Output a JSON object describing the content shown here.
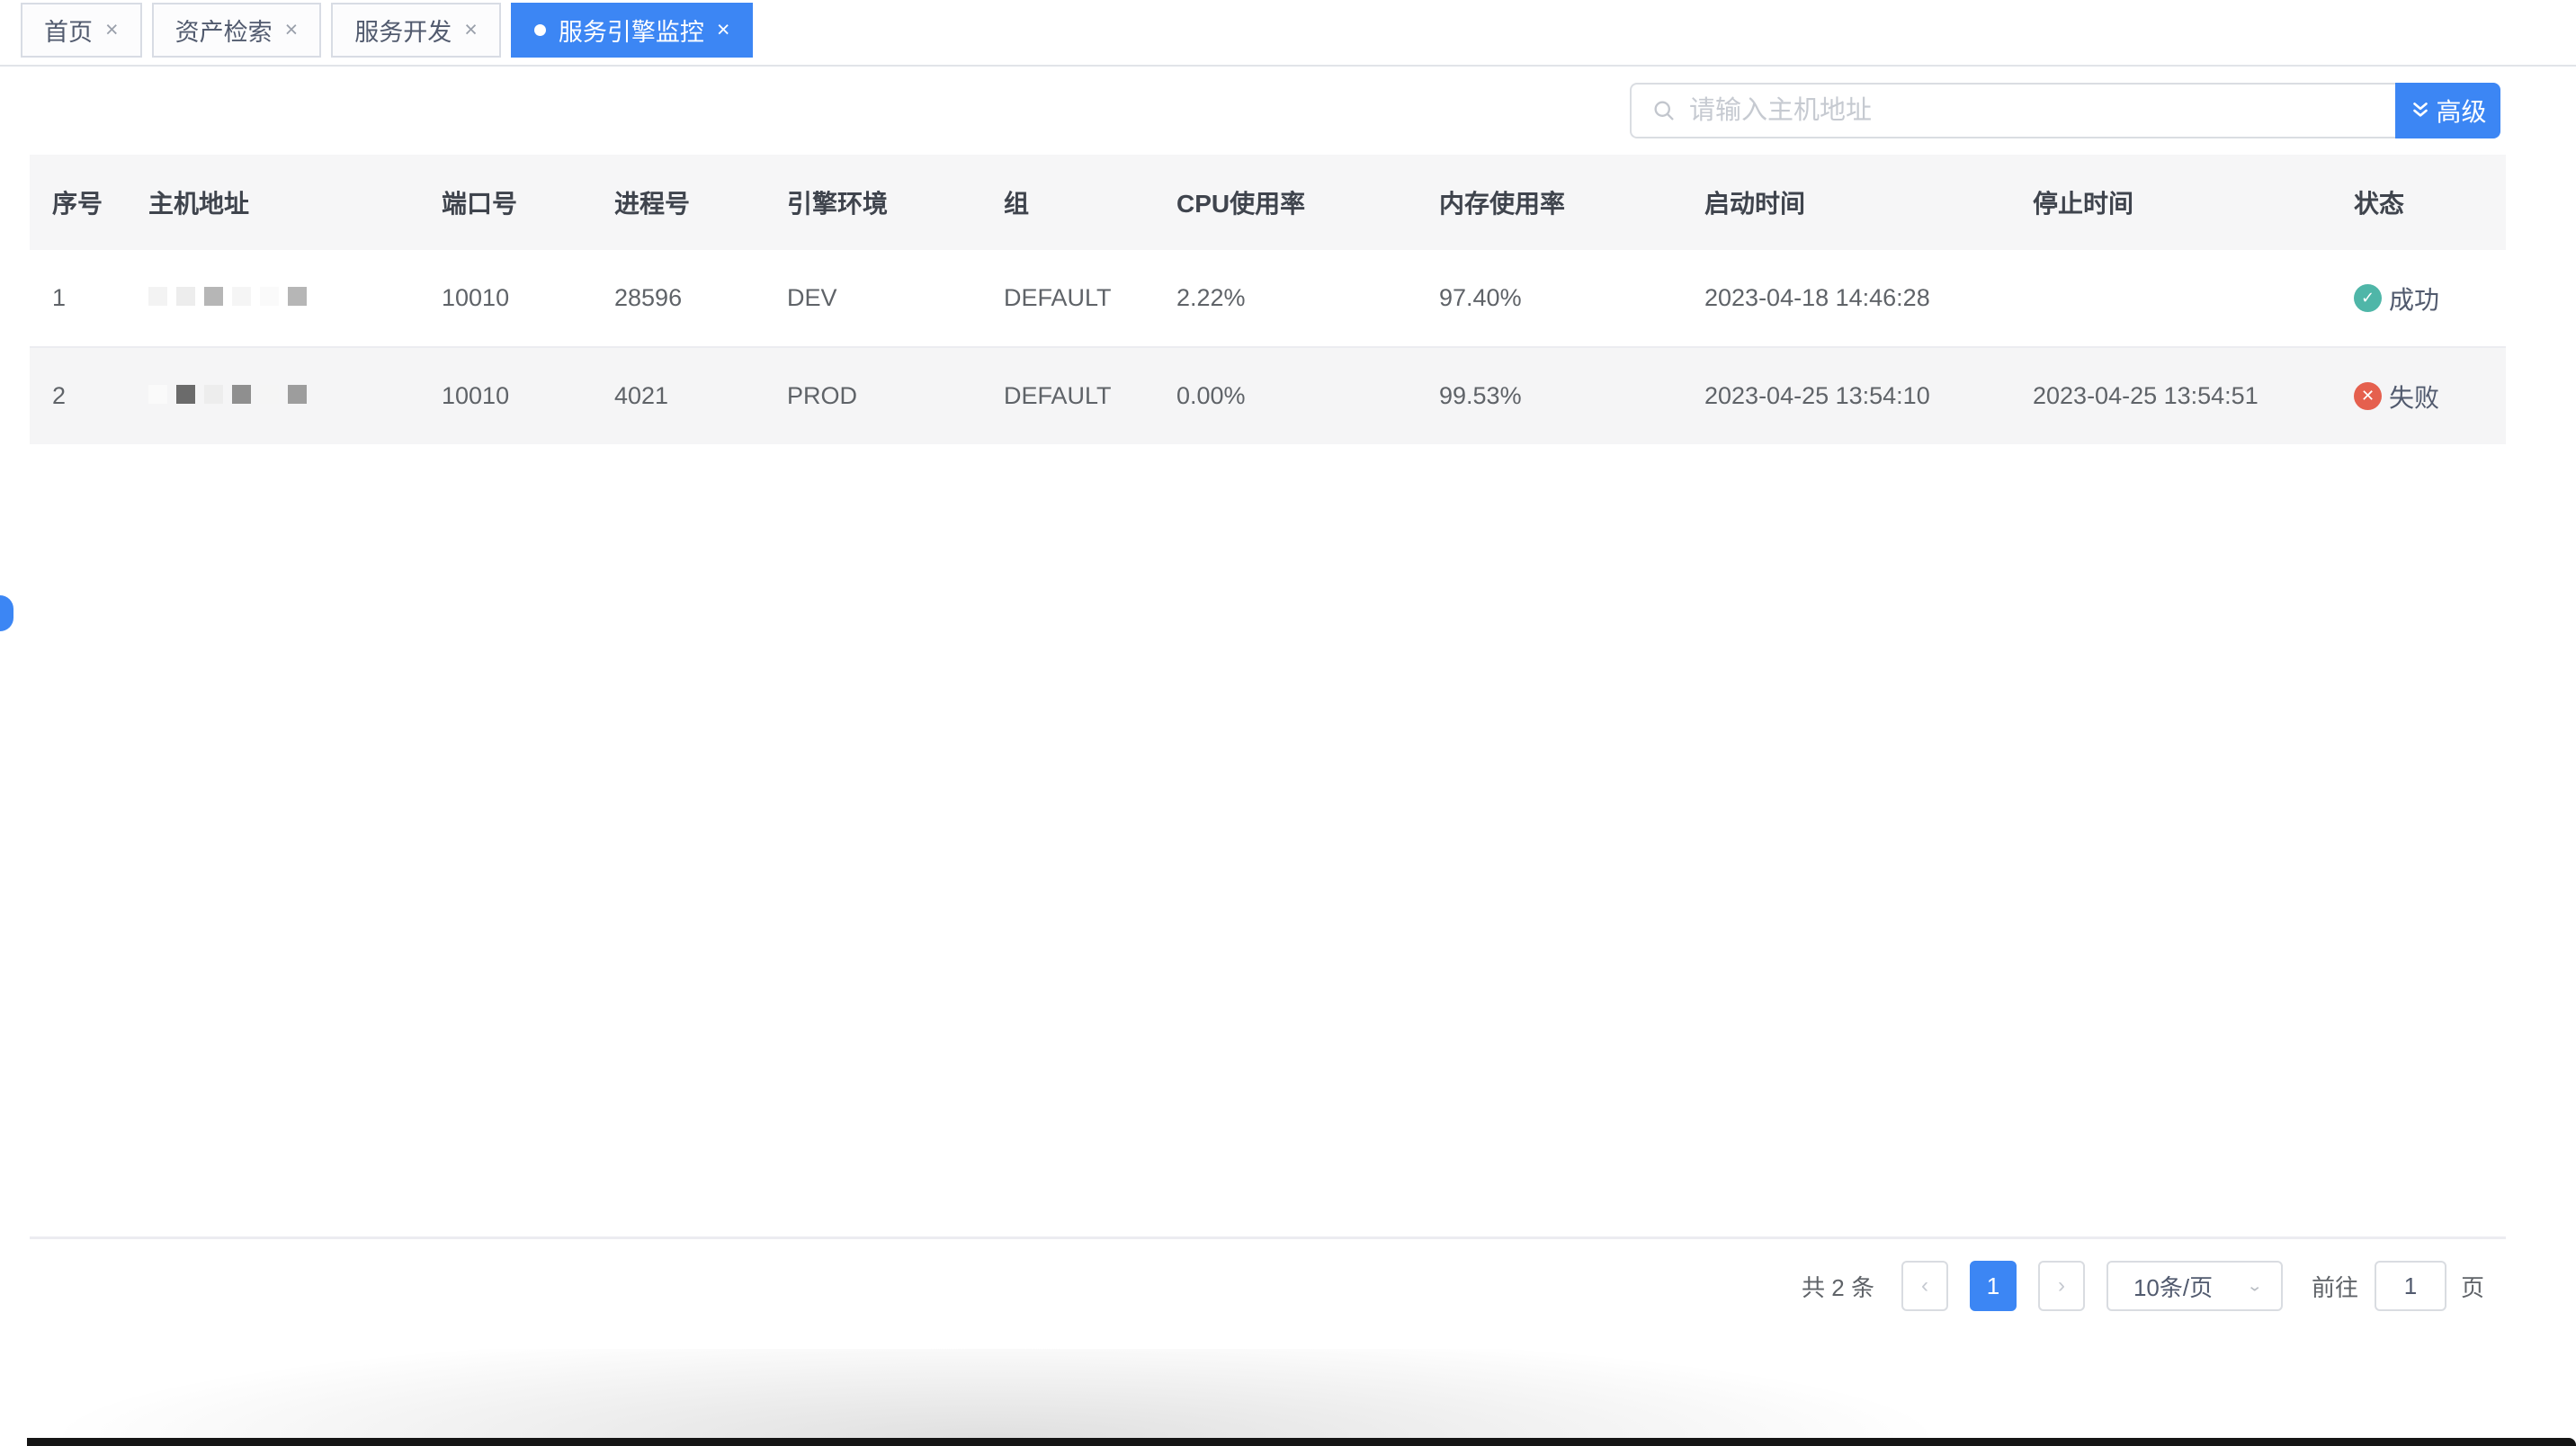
{
  "tabs": [
    {
      "label": "首页",
      "active": false
    },
    {
      "label": "资产检索",
      "active": false
    },
    {
      "label": "服务开发",
      "active": false
    },
    {
      "label": "服务引擎监控",
      "active": true
    }
  ],
  "icons": {
    "close": "×",
    "prev": "‹",
    "next": "›",
    "chevron_down": "⌄",
    "check": "✓",
    "cross": "✕"
  },
  "search": {
    "placeholder": "请输入主机地址",
    "advanced_label": "高级"
  },
  "table": {
    "columns": [
      "序号",
      "主机地址",
      "端口号",
      "进程号",
      "引擎环境",
      "组",
      "CPU使用率",
      "内存使用率",
      "启动时间",
      "停止时间",
      "状态"
    ],
    "rows": [
      {
        "index": "1",
        "host_redacted": true,
        "host_blocks": [
          "#f3f3f3",
          "#ededed",
          "#b6b6b6",
          "#f5f5f5",
          "#fafafa",
          "#b6b6b6"
        ],
        "port": "10010",
        "pid": "28596",
        "env": "DEV",
        "group": "DEFAULT",
        "cpu": "2.22%",
        "memory": "97.40%",
        "start_time": "2023-04-18 14:46:28",
        "stop_time": "",
        "status": "success",
        "status_label": "成功"
      },
      {
        "index": "2",
        "host_redacted": true,
        "host_blocks": [
          "#fafafa",
          "#6b6b6b",
          "#ededed",
          "#8f8f8f",
          "#f5f5f5",
          "#9d9d9d"
        ],
        "port": "10010",
        "pid": "4021",
        "env": "PROD",
        "group": "DEFAULT",
        "cpu": "0.00%",
        "memory": "99.53%",
        "start_time": "2023-04-25 13:54:10",
        "stop_time": "2023-04-25 13:54:51",
        "status": "fail",
        "status_label": "失败"
      }
    ]
  },
  "pagination": {
    "total_label": "共 2 条",
    "current_page": "1",
    "page_size_label": "10条/页",
    "goto_label": "前往",
    "goto_value": "1",
    "page_unit_label": "页"
  },
  "colors": {
    "accent_blue": "#3c86f4",
    "success_teal": "#4fb6a8",
    "error_red": "#e5604e",
    "header_bg": "#f6f6f7",
    "stripe_bg": "#f5f5f6"
  }
}
